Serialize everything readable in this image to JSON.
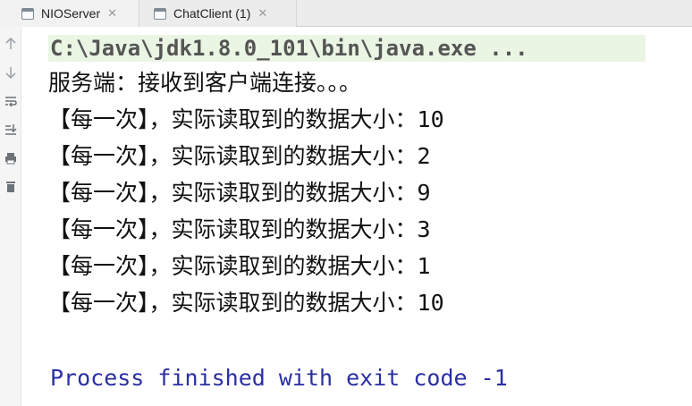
{
  "tabs": [
    {
      "label": "NIOServer",
      "icon": "console-icon"
    },
    {
      "label": "ChatClient (1)",
      "icon": "console-icon"
    }
  ],
  "gutter": {
    "buttons": [
      "up-arrow-icon",
      "down-arrow-icon",
      "soft-wrap-icon",
      "scroll-to-end-icon",
      "print-icon",
      "trash-icon"
    ]
  },
  "console": {
    "command_line": "C:\\Java\\jdk1.8.0_101\\bin\\java.exe ...",
    "server_message": "服务端：接收到客户端连接。。。",
    "read_lines": [
      {
        "prefix": "【每一次】，实际读取到的数据大小：",
        "value": "10"
      },
      {
        "prefix": "【每一次】，实际读取到的数据大小：",
        "value": "2"
      },
      {
        "prefix": "【每一次】，实际读取到的数据大小：",
        "value": "9"
      },
      {
        "prefix": "【每一次】，实际读取到的数据大小：",
        "value": "3"
      },
      {
        "prefix": "【每一次】，实际读取到的数据大小：",
        "value": "1"
      },
      {
        "prefix": "【每一次】，实际读取到的数据大小：",
        "value": "10"
      }
    ],
    "exit_message": "Process finished with exit code -1"
  },
  "colors": {
    "command_text": "#555555",
    "command_background": "#eaf5e4",
    "exit_text": "#2b2fa1",
    "output_text": "#111111"
  }
}
